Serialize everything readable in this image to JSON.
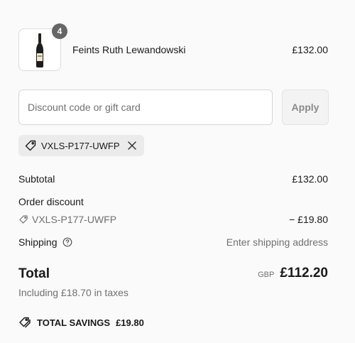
{
  "product": {
    "quantity": "4",
    "name": "Feints Ruth Lewandowski",
    "price": "£132.00",
    "image_icon": "wine-bottle-image"
  },
  "discount": {
    "placeholder": "Discount code or gift card",
    "apply_label": "Apply",
    "applied_code": "VXLS-P177-UWFP"
  },
  "summary": {
    "subtotal_label": "Subtotal",
    "subtotal_value": "£132.00",
    "order_discount_label": "Order discount",
    "order_discount_code": "VXLS-P177-UWFP",
    "order_discount_value": "− £19.80",
    "shipping_label": "Shipping",
    "shipping_value": "Enter shipping address",
    "total_label": "Total",
    "currency": "GBP",
    "total_value": "£112.20",
    "taxes_note": "Including £18.70 in taxes",
    "savings_label": "TOTAL SAVINGS",
    "savings_value": "£19.80"
  },
  "colors": {
    "background": "#fafafa",
    "muted_text": "#707070",
    "chip_bg": "#ebebeb",
    "badge_bg": "#666666"
  }
}
